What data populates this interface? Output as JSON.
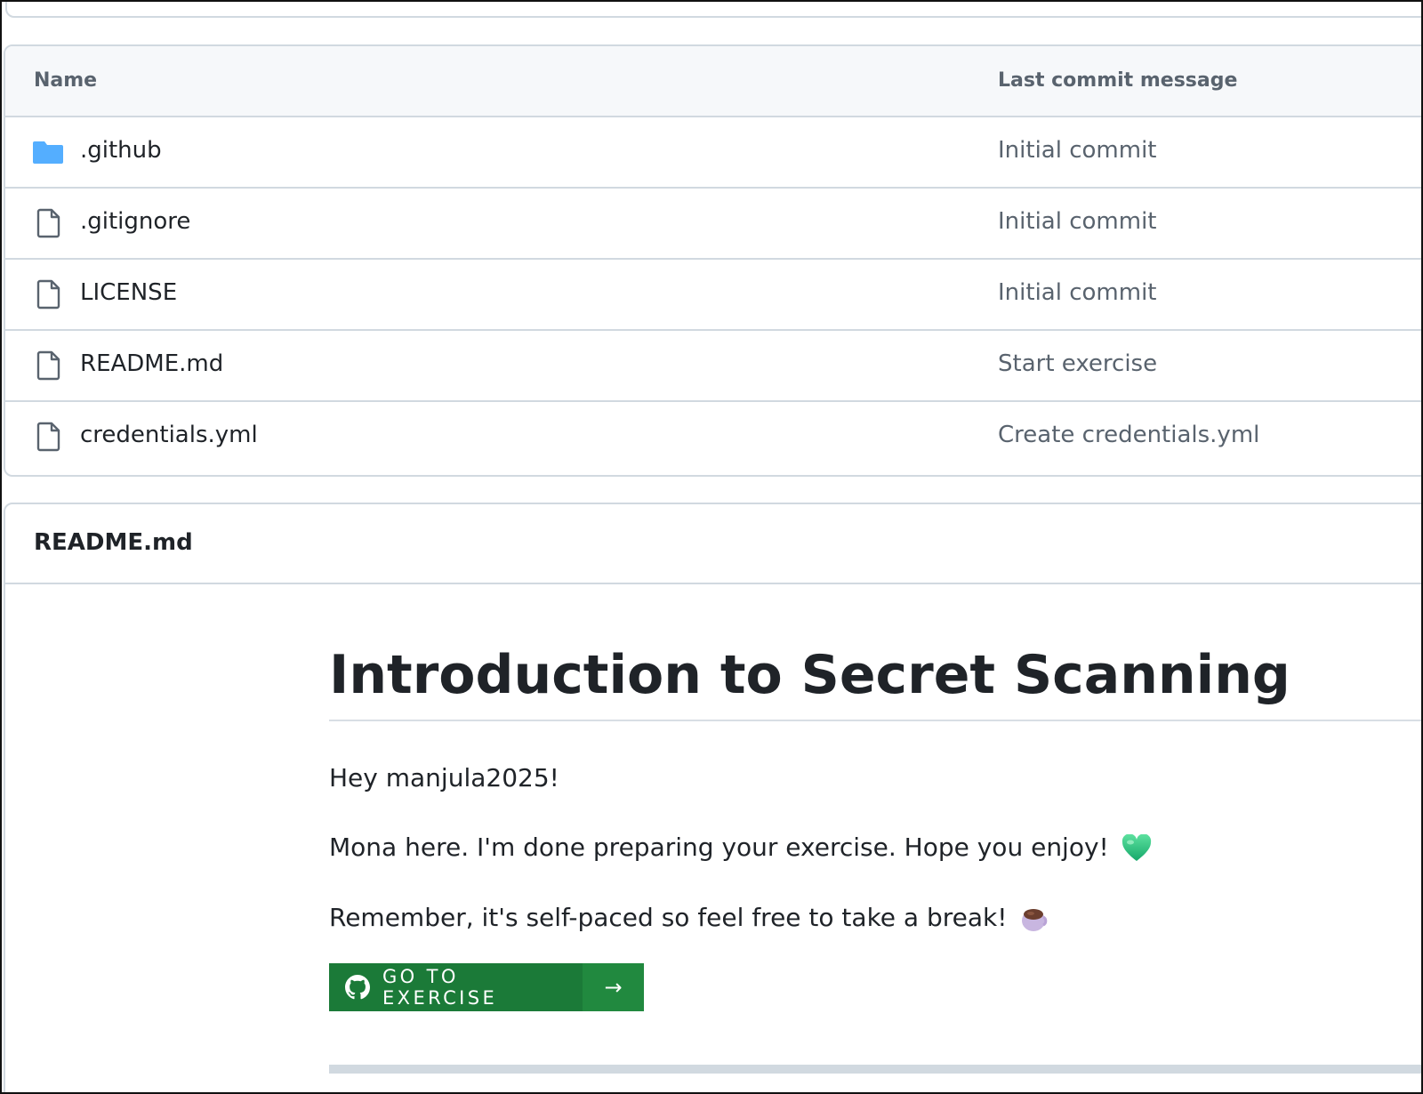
{
  "file_table": {
    "headers": {
      "name": "Name",
      "last_commit_message": "Last commit message"
    },
    "rows": [
      {
        "name": ".github",
        "message": "Initial commit",
        "icon": "folder-icon"
      },
      {
        "name": ".gitignore",
        "message": "Initial commit",
        "icon": "file-icon"
      },
      {
        "name": "LICENSE",
        "message": "Initial commit",
        "icon": "file-icon"
      },
      {
        "name": "README.md",
        "message": "Start exercise",
        "icon": "file-icon"
      },
      {
        "name": "credentials.yml",
        "message": "Create credentials.yml",
        "icon": "file-icon"
      }
    ]
  },
  "readme": {
    "filename": "README.md",
    "heading": "Introduction to Secret Scanning",
    "greeting": "Hey manjula2025!",
    "line2": "Mona here. I'm done preparing your exercise. Hope you enjoy!",
    "line2_emoji": "green-heart-icon",
    "line3": "Remember, it's self-paced so feel free to take a break!",
    "line3_emoji": "coffee-icon",
    "button": {
      "label": "GO TO EXERCISE",
      "arrow": "→",
      "icon": "github-icon"
    }
  },
  "colors": {
    "folder": "#54aeff",
    "button_main": "#1b7a38",
    "button_arrow": "#21893f",
    "border": "#d1d9e0"
  }
}
